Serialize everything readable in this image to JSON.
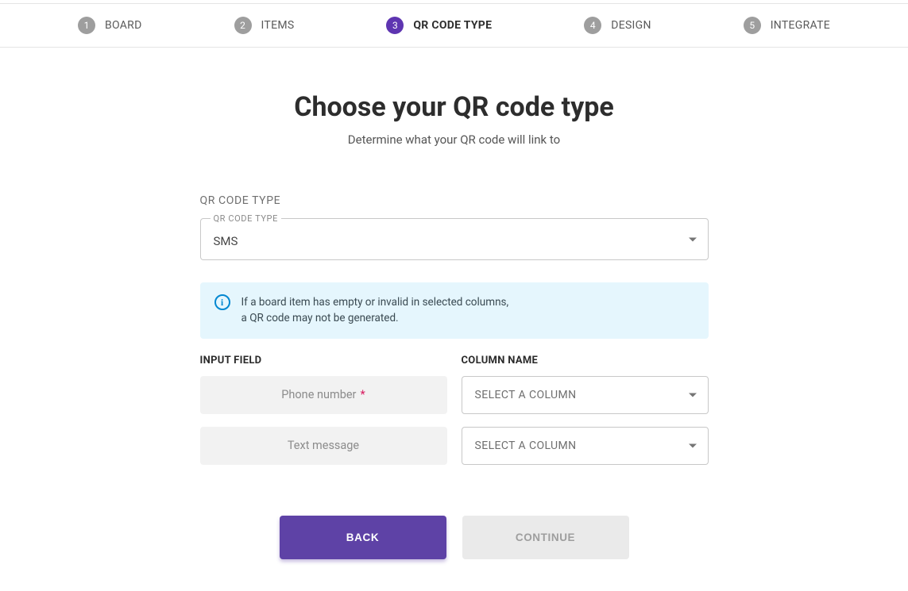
{
  "stepper": {
    "steps": [
      {
        "num": "1",
        "label": "BOARD"
      },
      {
        "num": "2",
        "label": "ITEMS"
      },
      {
        "num": "3",
        "label": "QR CODE TYPE"
      },
      {
        "num": "4",
        "label": "DESIGN"
      },
      {
        "num": "5",
        "label": "INTEGRATE"
      }
    ],
    "active_index": 2
  },
  "header": {
    "title": "Choose your QR code type",
    "subtitle": "Determine what your QR code will link to"
  },
  "qr_type_section": {
    "label": "QR CODE TYPE",
    "select_floating": "QR CODE TYPE",
    "select_value": "SMS"
  },
  "info": {
    "line1": "If a board item has empty or invalid in selected columns,",
    "line2": "a QR code may not be generated."
  },
  "mapping": {
    "input_header": "INPUT FIELD",
    "column_header": "COLUMN NAME",
    "column_placeholder": "SELECT A COLUMN",
    "fields": [
      {
        "label": "Phone number",
        "required": true
      },
      {
        "label": "Text message",
        "required": false
      }
    ]
  },
  "actions": {
    "back": "BACK",
    "continue": "CONTINUE"
  }
}
